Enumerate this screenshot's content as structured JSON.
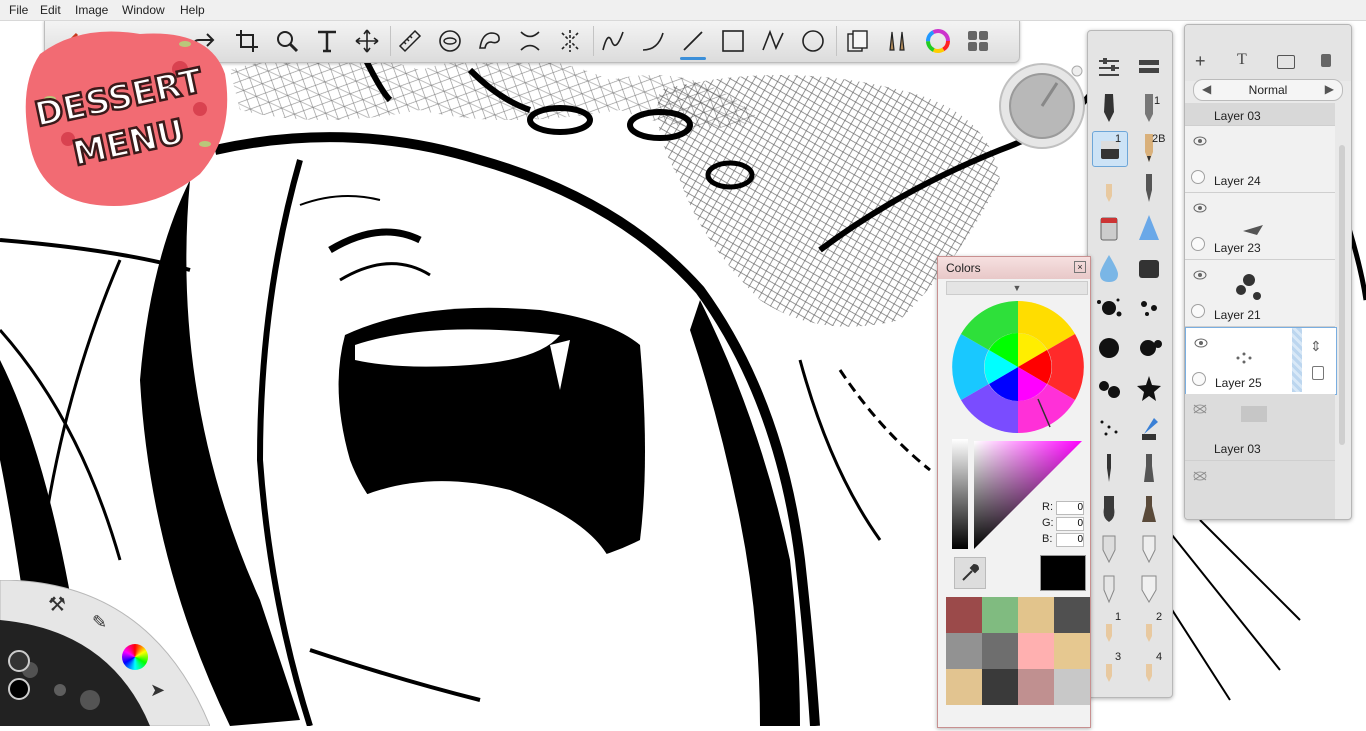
{
  "menu": [
    "File",
    "Edit",
    "Image",
    "Window",
    "Help"
  ],
  "logo": {
    "line1": "DESSERT",
    "line2": "MENU"
  },
  "toolbar": {
    "tools": [
      "undo-icon",
      "redo-icon",
      "crop-icon",
      "zoom-icon",
      "text-icon",
      "transform-icon",
      "ruler-icon",
      "ellipse-guide-icon",
      "french-curve-icon",
      "symmetry-icon",
      "perspective-icon",
      "stroke-icon",
      "curve-icon",
      "line-icon",
      "rectangle-icon",
      "polyline-icon",
      "ellipse-icon",
      "copic-library-icon",
      "brush-library-icon",
      "color-wheel-icon",
      "layout-icon"
    ],
    "active_tool": "line-icon"
  },
  "layers": {
    "blend_mode": "Normal",
    "items": [
      {
        "name": "Layer 03",
        "visible": true
      },
      {
        "name": "Layer 24",
        "visible": true
      },
      {
        "name": "Layer 23",
        "visible": true
      },
      {
        "name": "Layer 21",
        "visible": true
      },
      {
        "name": "Layer 25",
        "visible": true,
        "selected": true
      },
      {
        "name": "Layer 03",
        "visible": false
      }
    ]
  },
  "colors": {
    "title": "Colors",
    "r_label": "R:",
    "g_label": "G:",
    "b_label": "B:",
    "r": "0",
    "g": "0",
    "b": "0",
    "current": "#000000",
    "swatches": [
      "#9b4a4a",
      "#80bb80",
      "#e2c48c",
      "#505050",
      "#929292",
      "#6e6e6e",
      "#ffb0b0",
      "#e6c890",
      "#e2c490",
      "#3a3a3a",
      "#c09090",
      "#c8c8c8"
    ]
  },
  "brushes": {
    "numbers": [
      "1",
      "2B",
      "1",
      "1",
      "2",
      "3",
      "4"
    ]
  },
  "accent": "#3b8fd9"
}
